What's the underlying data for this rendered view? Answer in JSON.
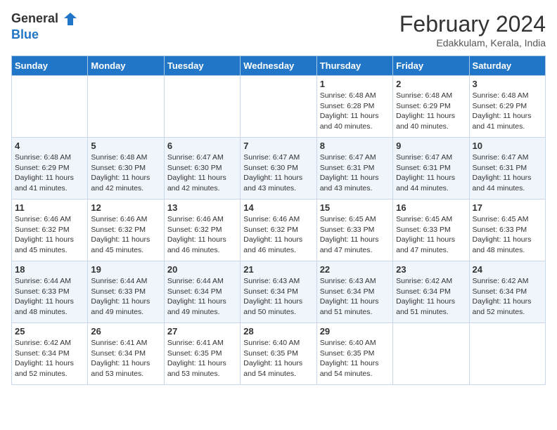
{
  "header": {
    "logo_general": "General",
    "logo_blue": "Blue",
    "month_title": "February 2024",
    "subtitle": "Edakkulam, Kerala, India"
  },
  "days_of_week": [
    "Sunday",
    "Monday",
    "Tuesday",
    "Wednesday",
    "Thursday",
    "Friday",
    "Saturday"
  ],
  "weeks": [
    [
      {
        "day": "",
        "info": ""
      },
      {
        "day": "",
        "info": ""
      },
      {
        "day": "",
        "info": ""
      },
      {
        "day": "",
        "info": ""
      },
      {
        "day": "1",
        "info": "Sunrise: 6:48 AM\nSunset: 6:28 PM\nDaylight: 11 hours and 40 minutes."
      },
      {
        "day": "2",
        "info": "Sunrise: 6:48 AM\nSunset: 6:29 PM\nDaylight: 11 hours and 40 minutes."
      },
      {
        "day": "3",
        "info": "Sunrise: 6:48 AM\nSunset: 6:29 PM\nDaylight: 11 hours and 41 minutes."
      }
    ],
    [
      {
        "day": "4",
        "info": "Sunrise: 6:48 AM\nSunset: 6:29 PM\nDaylight: 11 hours and 41 minutes."
      },
      {
        "day": "5",
        "info": "Sunrise: 6:48 AM\nSunset: 6:30 PM\nDaylight: 11 hours and 42 minutes."
      },
      {
        "day": "6",
        "info": "Sunrise: 6:47 AM\nSunset: 6:30 PM\nDaylight: 11 hours and 42 minutes."
      },
      {
        "day": "7",
        "info": "Sunrise: 6:47 AM\nSunset: 6:30 PM\nDaylight: 11 hours and 43 minutes."
      },
      {
        "day": "8",
        "info": "Sunrise: 6:47 AM\nSunset: 6:31 PM\nDaylight: 11 hours and 43 minutes."
      },
      {
        "day": "9",
        "info": "Sunrise: 6:47 AM\nSunset: 6:31 PM\nDaylight: 11 hours and 44 minutes."
      },
      {
        "day": "10",
        "info": "Sunrise: 6:47 AM\nSunset: 6:31 PM\nDaylight: 11 hours and 44 minutes."
      }
    ],
    [
      {
        "day": "11",
        "info": "Sunrise: 6:46 AM\nSunset: 6:32 PM\nDaylight: 11 hours and 45 minutes."
      },
      {
        "day": "12",
        "info": "Sunrise: 6:46 AM\nSunset: 6:32 PM\nDaylight: 11 hours and 45 minutes."
      },
      {
        "day": "13",
        "info": "Sunrise: 6:46 AM\nSunset: 6:32 PM\nDaylight: 11 hours and 46 minutes."
      },
      {
        "day": "14",
        "info": "Sunrise: 6:46 AM\nSunset: 6:32 PM\nDaylight: 11 hours and 46 minutes."
      },
      {
        "day": "15",
        "info": "Sunrise: 6:45 AM\nSunset: 6:33 PM\nDaylight: 11 hours and 47 minutes."
      },
      {
        "day": "16",
        "info": "Sunrise: 6:45 AM\nSunset: 6:33 PM\nDaylight: 11 hours and 47 minutes."
      },
      {
        "day": "17",
        "info": "Sunrise: 6:45 AM\nSunset: 6:33 PM\nDaylight: 11 hours and 48 minutes."
      }
    ],
    [
      {
        "day": "18",
        "info": "Sunrise: 6:44 AM\nSunset: 6:33 PM\nDaylight: 11 hours and 48 minutes."
      },
      {
        "day": "19",
        "info": "Sunrise: 6:44 AM\nSunset: 6:33 PM\nDaylight: 11 hours and 49 minutes."
      },
      {
        "day": "20",
        "info": "Sunrise: 6:44 AM\nSunset: 6:34 PM\nDaylight: 11 hours and 49 minutes."
      },
      {
        "day": "21",
        "info": "Sunrise: 6:43 AM\nSunset: 6:34 PM\nDaylight: 11 hours and 50 minutes."
      },
      {
        "day": "22",
        "info": "Sunrise: 6:43 AM\nSunset: 6:34 PM\nDaylight: 11 hours and 51 minutes."
      },
      {
        "day": "23",
        "info": "Sunrise: 6:42 AM\nSunset: 6:34 PM\nDaylight: 11 hours and 51 minutes."
      },
      {
        "day": "24",
        "info": "Sunrise: 6:42 AM\nSunset: 6:34 PM\nDaylight: 11 hours and 52 minutes."
      }
    ],
    [
      {
        "day": "25",
        "info": "Sunrise: 6:42 AM\nSunset: 6:34 PM\nDaylight: 11 hours and 52 minutes."
      },
      {
        "day": "26",
        "info": "Sunrise: 6:41 AM\nSunset: 6:34 PM\nDaylight: 11 hours and 53 minutes."
      },
      {
        "day": "27",
        "info": "Sunrise: 6:41 AM\nSunset: 6:35 PM\nDaylight: 11 hours and 53 minutes."
      },
      {
        "day": "28",
        "info": "Sunrise: 6:40 AM\nSunset: 6:35 PM\nDaylight: 11 hours and 54 minutes."
      },
      {
        "day": "29",
        "info": "Sunrise: 6:40 AM\nSunset: 6:35 PM\nDaylight: 11 hours and 54 minutes."
      },
      {
        "day": "",
        "info": ""
      },
      {
        "day": "",
        "info": ""
      }
    ]
  ]
}
